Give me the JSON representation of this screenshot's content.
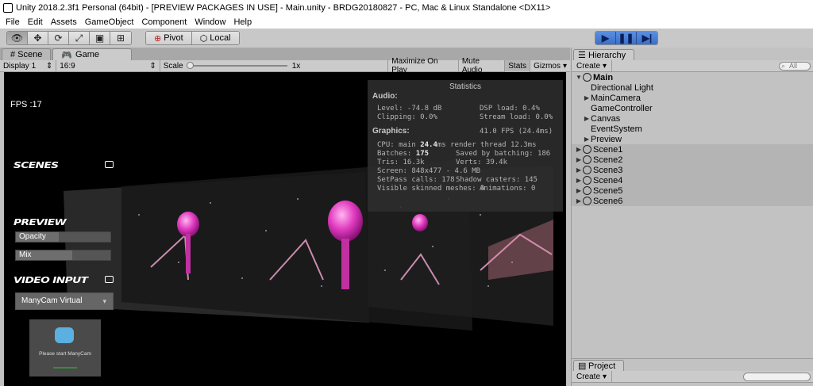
{
  "window": {
    "title": "Unity 2018.2.3f1 Personal (64bit) - [PREVIEW PACKAGES IN USE] - Main.unity - BRDG20180827 - PC, Mac & Linux Standalone <DX11>"
  },
  "menu": [
    "File",
    "Edit",
    "Assets",
    "GameObject",
    "Component",
    "Window",
    "Help"
  ],
  "toolbar": {
    "tools": [
      "eye-icon",
      "move-icon",
      "rotate-icon",
      "scale-icon",
      "rect-icon",
      "transform-icon"
    ],
    "pivot_label": "Pivot",
    "local_label": "Local"
  },
  "tabs": {
    "scene": "Scene",
    "game": "Game"
  },
  "game_toolbar": {
    "display": "Display 1",
    "aspect": "16:9",
    "scale_label": "Scale",
    "scale_value": "1x",
    "maximize": "Maximize On Play",
    "mute": "Mute Audio",
    "stats": "Stats",
    "gizmos": "Gizmos"
  },
  "game_view": {
    "fps": "FPS :17",
    "scenes_label": "SCENES",
    "preview_label": "PREVIEW",
    "opacity_label": "Opacity",
    "opacity_value": 0.45,
    "mix_label": "Mix",
    "mix_value": 0.6,
    "video_input_label": "VIDEO INPUT",
    "video_source": "ManyCam Virtual",
    "manycam_msg": "Please start ManyCam"
  },
  "stats": {
    "title": "Statistics",
    "audio_header": "Audio:",
    "level": "Level: -74.8 dB",
    "dsp": "DSP load: 0.4%",
    "clipping": "Clipping: 0.0%",
    "stream": "Stream load: 0.0%",
    "graphics_header": "Graphics:",
    "fps": "41.0 FPS (24.4ms)",
    "cpu_prefix": "CPU: main ",
    "cpu_main": "24.4",
    "cpu_suffix": "ms  render thread 12.3ms",
    "batches_prefix": "Batches: ",
    "batches": "175",
    "saved_batching": "Saved by batching: 186",
    "tris": "Tris: 16.3k",
    "verts": "Verts: 39.4k",
    "screen": "Screen: 848x477 - 4.6 MB",
    "setpass": "SetPass calls: 178",
    "shadow": "Shadow casters: 145",
    "skinned": "Visible skinned meshes: 0",
    "animations": "Animations: 0"
  },
  "hierarchy": {
    "tab": "Hierarchy",
    "create": "Create",
    "search_placeholder": "All",
    "root": "Main",
    "children": [
      {
        "label": "Directional Light",
        "expandable": false
      },
      {
        "label": "MainCamera",
        "expandable": true
      },
      {
        "label": "GameController",
        "expandable": false
      },
      {
        "label": "Canvas",
        "expandable": true
      },
      {
        "label": "EventSystem",
        "expandable": false
      },
      {
        "label": "Preview",
        "expandable": true
      }
    ],
    "scenes": [
      "Scene1",
      "Scene2",
      "Scene3",
      "Scene4",
      "Scene5",
      "Scene6"
    ]
  },
  "project": {
    "tab": "Project",
    "create": "Create"
  }
}
